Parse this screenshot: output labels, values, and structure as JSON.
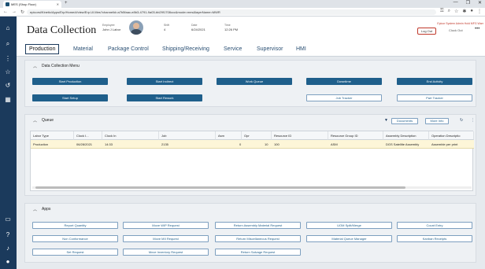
{
  "browser": {
    "tab_title": "MES (Shop Floor)",
    "new_tab": "+",
    "url": "epicorsi/Kinetic/Apps/Erp/Home/#/view/Erp.UI.Mes?channelid=a7b5faac-e8b3-4791-9a03-bb29f1708ccc&mode=mes&layerName=MWR"
  },
  "header": {
    "title": "Data Collection",
    "employee_label": "Employee",
    "employee_value": "John J Labor",
    "shift_label": "Shift",
    "shift_value": "4",
    "date_label": "Date",
    "date_value": "6/24/2021",
    "time_label": "Time",
    "time_value": "12:26 PM",
    "notice": "Epicor System Admin  Hold MFG  Warr",
    "logout": "Log Out",
    "clockout": "Clock Out",
    "more": "•••"
  },
  "tabs": [
    "Production",
    "Material",
    "Package Control",
    "Shipping/Receiving",
    "Service",
    "Supervisor",
    "HMI"
  ],
  "dc_menu": {
    "title": "Data Collection Menu",
    "row1": [
      "Start Production",
      "Start Indirect",
      "Work Queue",
      "Downtime",
      "End Activity"
    ],
    "row2": [
      "Start Setup",
      "Start Rework"
    ],
    "row2_white": [
      "Job Tracker",
      "Part Tracker"
    ]
  },
  "queue": {
    "title": "Queue",
    "documents": "Documents",
    "more_info": "More Info",
    "columns": [
      "Labor Type",
      "Clock I...",
      "Clock In",
      "Job",
      "Asm",
      "Opr",
      "Resource ID",
      "Resource Group ID",
      "Assembly Description",
      "Operation Descriptio"
    ],
    "row": [
      "Production",
      "06/28/2021",
      "14:33",
      "2135",
      "0",
      "10",
      "100",
      "ASM",
      "DGS Satellite Assembly",
      "Assemble per print"
    ]
  },
  "apps": {
    "title": "Apps",
    "buttons": [
      [
        "Report Quantity",
        "Move WIP Request",
        "Return Assembly Material Request",
        "UOM Split/Merge",
        "Count Entry"
      ],
      [
        "Non Conformance",
        "Move MII Request",
        "Return Miscellaneous Request",
        "Material Queue Manager",
        "Kanban Receipts"
      ],
      [
        "Set Request",
        "Move Inventory Request",
        "Return Salvage Request"
      ]
    ]
  }
}
